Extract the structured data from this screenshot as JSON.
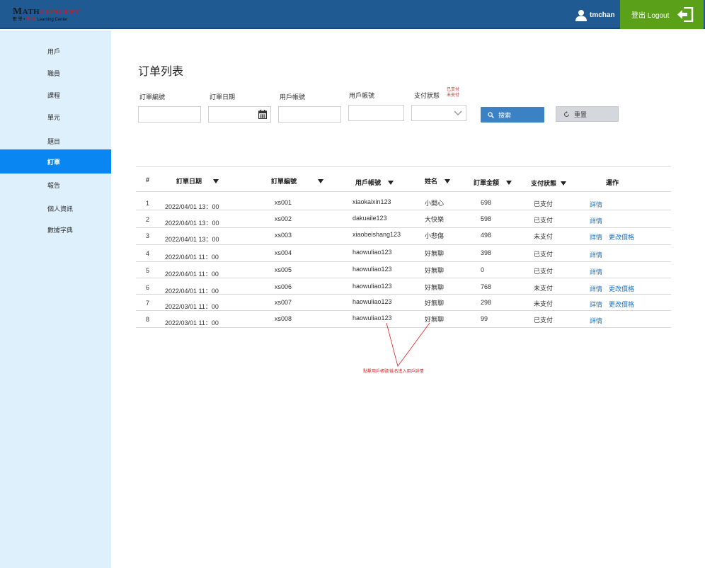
{
  "logo": {
    "brand_a": "M",
    "brand_b": "ATH",
    "brand_c": "CONCEPT",
    "sub_a": "數 學 •",
    "sub_b": "思 維",
    "sub_c": "Learning Center"
  },
  "header": {
    "username": "tmchan",
    "logout_label": "登出 Logout"
  },
  "sidebar": {
    "items": [
      "用戶",
      "職員",
      "課程",
      "單元",
      "題目",
      "訂單",
      "報告",
      "個人資訊",
      "數據字典"
    ],
    "active_index": 5
  },
  "page": {
    "title": "订单列表"
  },
  "filters": {
    "order_no_label": "訂單編號",
    "order_date_label": "訂單日期",
    "account_label": "用戶帳號",
    "account2_label": "用戶帳號",
    "pay_status_label": "支付狀態",
    "pay_options": [
      "已支付",
      "未支付"
    ],
    "search_label": "搜索",
    "reset_label": "重置"
  },
  "table": {
    "headers": [
      "#",
      "訂單日期",
      "訂單編號",
      "用戶帳號",
      "姓名",
      "訂單金額",
      "支付狀態",
      "運作"
    ],
    "rows": [
      {
        "no": "1",
        "date": "2022/04/01 13：00",
        "order": "xs001",
        "account": "xiaokaixin123",
        "name": "小開心",
        "amount": "698",
        "status": "已支付",
        "actions": [
          "詳情"
        ]
      },
      {
        "no": "2",
        "date": "2022/04/01 13：00",
        "order": "xs002",
        "account": "dakuaile123",
        "name": "大快樂",
        "amount": "598",
        "status": "已支付",
        "actions": [
          "詳情"
        ]
      },
      {
        "no": "3",
        "date": "2022/04/01 13：00",
        "order": "xs003",
        "account": "xiaobeishang123",
        "name": "小悲傷",
        "amount": "498",
        "status": "未支付",
        "actions": [
          "詳情",
          "更改價格"
        ]
      },
      {
        "no": "4",
        "date": "2022/04/01 11：00",
        "order": "xs004",
        "account": "haowuliao123",
        "name": "好無聊",
        "amount": "398",
        "status": "已支付",
        "actions": [
          "詳情"
        ]
      },
      {
        "no": "5",
        "date": "2022/04/01 11：00",
        "order": "xs005",
        "account": "haowuliao123",
        "name": "好無聊",
        "amount": "0",
        "status": "已支付",
        "actions": [
          "詳情"
        ]
      },
      {
        "no": "6",
        "date": "2022/04/01 11：00",
        "order": "xs006",
        "account": "haowuliao123",
        "name": "好無聊",
        "amount": "768",
        "status": "未支付",
        "actions": [
          "詳情",
          "更改價格"
        ]
      },
      {
        "no": "7",
        "date": "2022/03/01 11：00",
        "order": "xs007",
        "account": "haowuliao123",
        "name": "好無聊",
        "amount": "298",
        "status": "未支付",
        "actions": [
          "詳情",
          "更改價格"
        ]
      },
      {
        "no": "8",
        "date": "2022/03/01 11：00",
        "order": "xs008",
        "account": "haowuliao123",
        "name": "好無聊",
        "amount": "99",
        "status": "已支付",
        "actions": [
          "詳情"
        ]
      }
    ]
  },
  "annotation": {
    "text": "點擊用戶帳號/姓名進入用戶詳情",
    "color": "#e02020"
  },
  "colors": {
    "header": "#1f5a92",
    "logout": "#5aa119",
    "sidebar": "#dff0fd",
    "active": "#0a86f2",
    "link": "#1a73c9"
  }
}
